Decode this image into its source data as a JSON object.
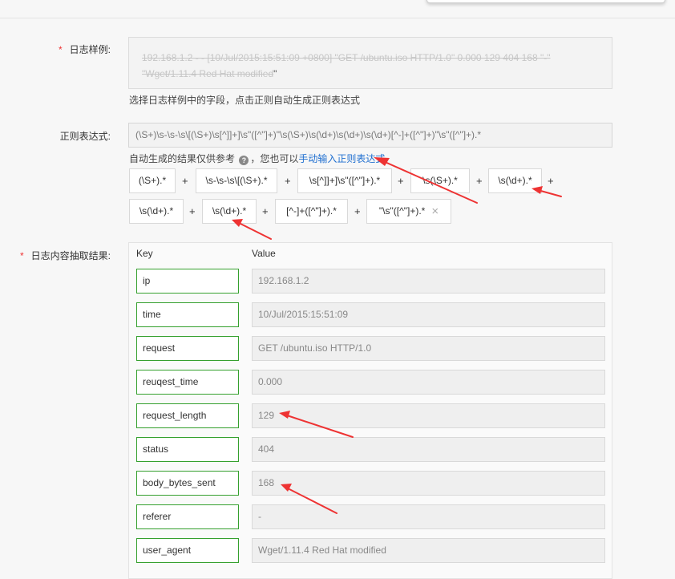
{
  "form": {
    "required_mark": "*",
    "sample": {
      "label": "日志样例:",
      "text_struck": "192.168.1.2 - - [10/Jul/2015:15:51:09 +0800] \"GET /ubuntu.iso HTTP/1.0\" 0.000 129 404 168 \"-\" \"Wget/1.11.4 Red Hat modified",
      "text_tail": "\"",
      "hint": "选择日志样例中的字段，点击正则自动生成正则表达式"
    },
    "regex": {
      "label": "正则表达式:",
      "value": "(\\S+)\\s-\\s-\\s\\[(\\S+)\\s[^]]+]\\s\"([^\"]+)\"\\s(\\S+)\\s(\\d+)\\s(\\d+)\\s(\\d+)[^-]+([^\"]+)\"\\s\"([^\"]+).*",
      "hint_text": "自动生成的结果仅供参考",
      "help_icon": "question-circle-icon",
      "hint_mid": "，您也可以",
      "manual_link": "手动输入正则表达式"
    },
    "tokens": [
      "(\\S+).*",
      "\\s-\\s-\\s\\[(\\S+).*",
      "\\s[^]]+]\\s\"([^\"]+).*",
      "\\s(\\S+).*",
      "\\s(\\d+).*",
      "\\s(\\d+).*",
      "\\s(\\d+).*",
      "[^-]+([^\"]+).*",
      "\"\\s\"([^\"]+).*"
    ],
    "plus": "+",
    "remove_icon": "×",
    "results": {
      "label": "日志内容抽取结果:",
      "key_header": "Key",
      "value_header": "Value",
      "rows": [
        {
          "key": "ip",
          "value": "192.168.1.2"
        },
        {
          "key": "time",
          "value": "10/Jul/2015:15:51:09"
        },
        {
          "key": "request",
          "value": "GET /ubuntu.iso HTTP/1.0"
        },
        {
          "key": "reuqest_time",
          "value": "0.000"
        },
        {
          "key": "request_length",
          "value": "129"
        },
        {
          "key": "status",
          "value": "404"
        },
        {
          "key": "body_bytes_sent",
          "value": "168"
        },
        {
          "key": "referer",
          "value": "-"
        },
        {
          "key": "user_agent",
          "value": "Wget/1.11.4 Red Hat modified"
        }
      ]
    }
  },
  "colors": {
    "accent_link": "#1f6fd0",
    "required": "#e33333",
    "key_border": "#35a02e",
    "annotation_arrow": "#ee3333"
  }
}
